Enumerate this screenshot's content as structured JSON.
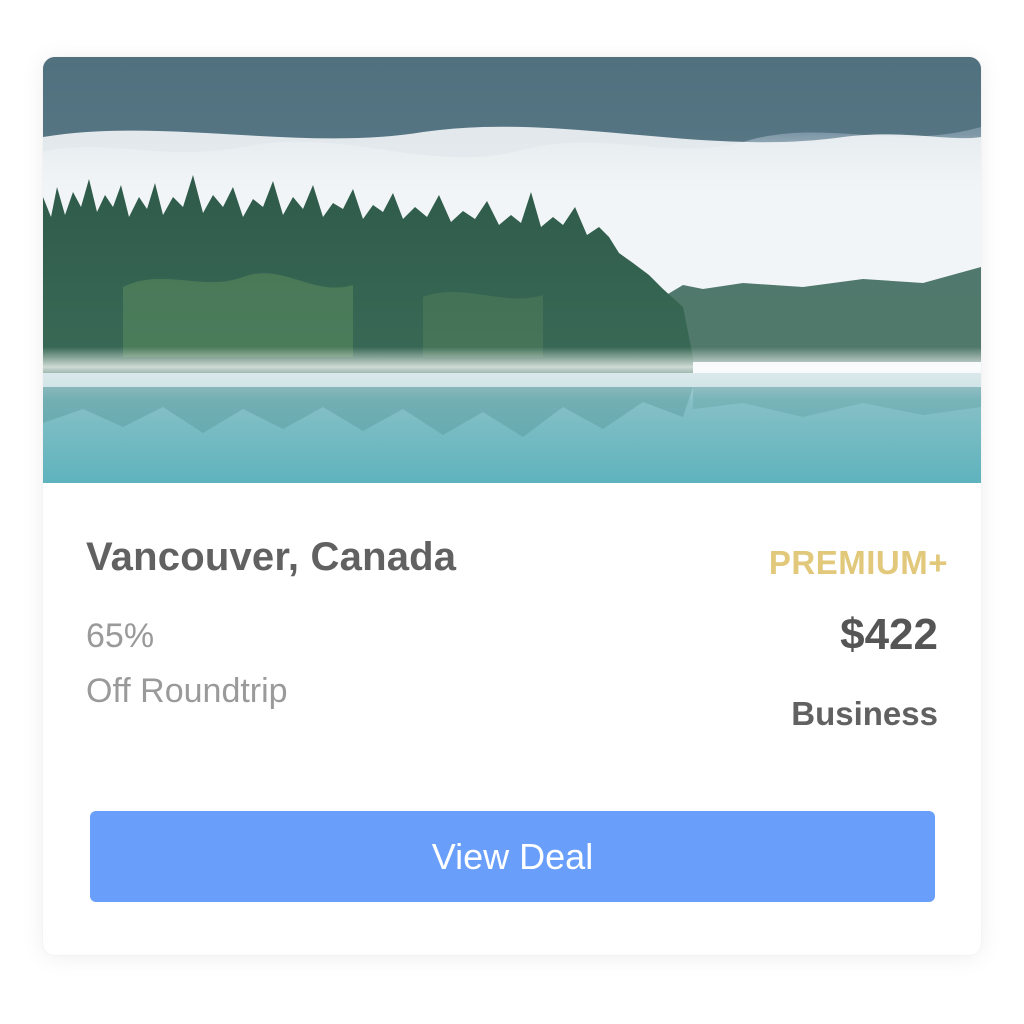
{
  "deal": {
    "destination": "Vancouver, Canada",
    "tier": "PREMIUM+",
    "discount": "65%",
    "discount_note": "Off Roundtrip",
    "price": "$422",
    "cabin_class": "Business",
    "cta_label": "View Deal"
  },
  "colors": {
    "tier_gold": "#e2c87a",
    "button_blue": "#699ffb",
    "title_gray": "#616161",
    "muted_gray": "#9a9a9a"
  }
}
